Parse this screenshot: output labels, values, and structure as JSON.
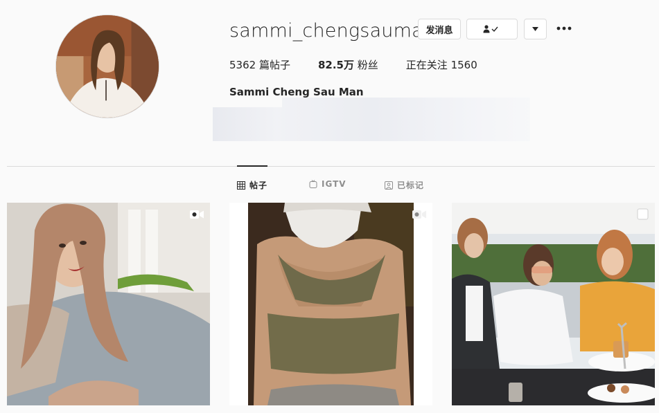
{
  "profile": {
    "username": "sammi_chengsauman",
    "full_name": "Sammi Cheng Sau Man",
    "buttons": {
      "message": "发消息",
      "follow_icon": "person-check-icon",
      "dropdown_icon": "caret-down-icon",
      "more_icon": "more-horizontal-icon"
    },
    "stats": {
      "posts_count": "5362",
      "posts_label": "篇帖子",
      "followers_count": "82.5万",
      "followers_label": "粉丝",
      "following_label": "正在关注",
      "following_count": "1560"
    }
  },
  "tabs": [
    {
      "label": "帖子",
      "icon": "grid-icon",
      "active": true
    },
    {
      "label": "IGTV",
      "icon": "igtv-icon",
      "active": false
    },
    {
      "label": "已标记",
      "icon": "tagged-icon",
      "active": false
    }
  ],
  "posts": [
    {
      "badge": "video-icon"
    },
    {
      "badge": "video-icon"
    },
    {
      "badge": "carousel-icon"
    }
  ],
  "colors": {
    "background": "#fafafa",
    "text": "#262626",
    "muted": "#8e8e8e",
    "border": "#dbdbdb"
  }
}
